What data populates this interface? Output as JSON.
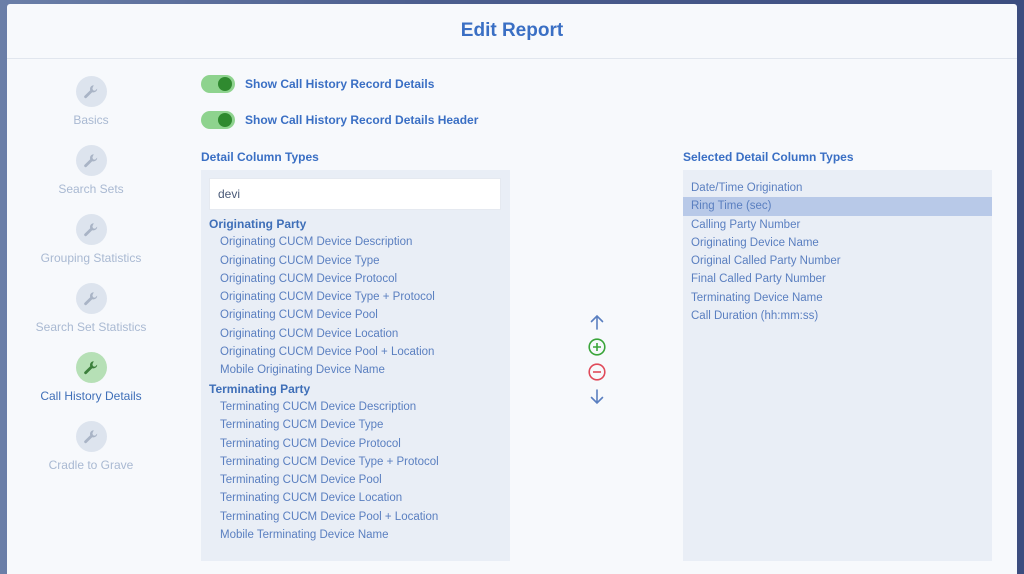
{
  "modal": {
    "title": "Edit Report"
  },
  "sidebar": {
    "items": [
      {
        "label": "Basics",
        "icon": "wrench-icon",
        "active": false
      },
      {
        "label": "Search Sets",
        "icon": "wrench-icon",
        "active": false
      },
      {
        "label": "Grouping Statistics",
        "icon": "wrench-icon",
        "active": false
      },
      {
        "label": "Search Set Statistics",
        "icon": "wrench-icon",
        "active": false
      },
      {
        "label": "Call History Details",
        "icon": "wrench-icon",
        "active": true
      },
      {
        "label": "Cradle to Grave",
        "icon": "wrench-icon",
        "active": false
      }
    ]
  },
  "toggles": {
    "details": {
      "label": "Show Call History Record Details",
      "on": true
    },
    "header": {
      "label": "Show Call History Record Details Header",
      "on": true
    }
  },
  "available": {
    "title": "Detail Column Types",
    "search_value": "devi",
    "groups": [
      {
        "name": "Originating Party",
        "items": [
          "Originating CUCM Device Description",
          "Originating CUCM Device Type",
          "Originating CUCM Device Protocol",
          "Originating CUCM Device Type + Protocol",
          "Originating CUCM Device Pool",
          "Originating CUCM Device Location",
          "Originating CUCM Device Pool + Location",
          "Mobile Originating Device Name"
        ]
      },
      {
        "name": "Terminating Party",
        "items": [
          "Terminating CUCM Device Description",
          "Terminating CUCM Device Type",
          "Terminating CUCM Device Protocol",
          "Terminating CUCM Device Type + Protocol",
          "Terminating CUCM Device Pool",
          "Terminating CUCM Device Location",
          "Terminating CUCM Device Pool + Location",
          "Mobile Terminating Device Name"
        ]
      }
    ]
  },
  "selected": {
    "title": "Selected Detail Column Types",
    "items": [
      "Date/Time Origination",
      "Ring Time (sec)",
      "Calling Party Number",
      "Originating Device Name",
      "Original Called Party Number",
      "Final Called Party Number",
      "Terminating Device Name",
      "Call Duration (hh:mm:ss)"
    ],
    "highlighted_index": 1
  },
  "controls": {
    "move_up": "arrow-up-icon",
    "add": "plus-circle-icon",
    "remove": "minus-circle-icon",
    "move_down": "arrow-down-icon"
  },
  "colors": {
    "accent": "#3a6fc4",
    "add": "#3aa53a",
    "remove": "#e04a5a",
    "toggle_on": "#8ed38e",
    "highlight": "#b8c9e8"
  }
}
